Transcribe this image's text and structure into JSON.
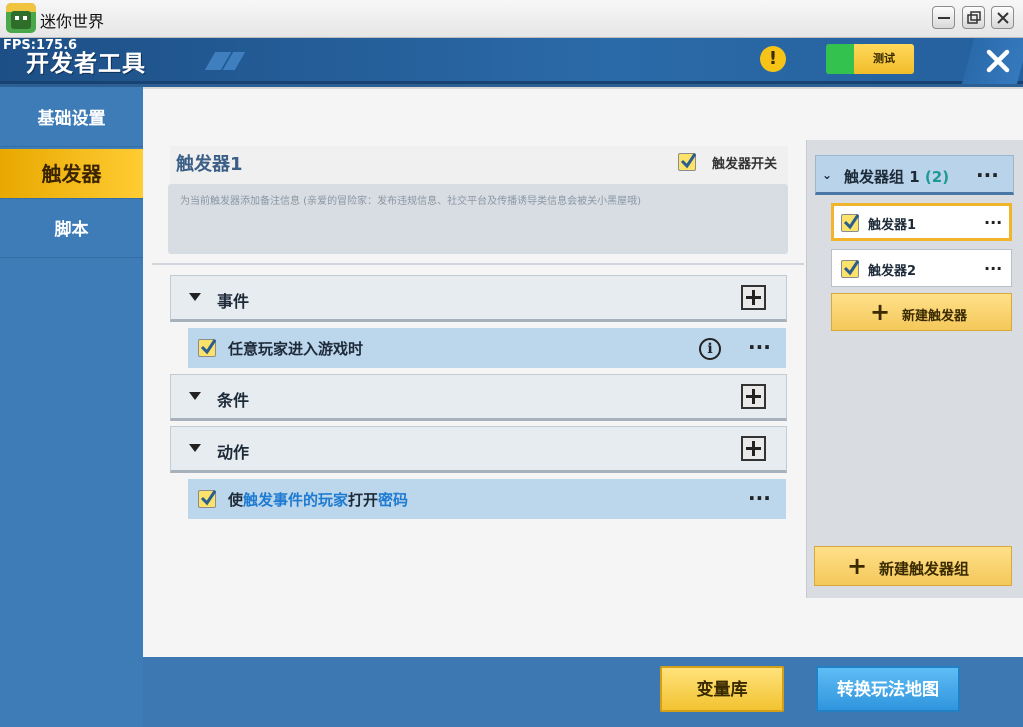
{
  "window": {
    "title": "迷你世界"
  },
  "header": {
    "fps": "FPS:175.6",
    "title": "开发者工具",
    "test_label": "测试"
  },
  "sidebar": {
    "items": [
      {
        "label": "基础设置"
      },
      {
        "label": "触发器"
      },
      {
        "label": "脚本"
      }
    ]
  },
  "trigger": {
    "name": "触发器1",
    "switch_label": "触发器开关",
    "note_placeholder": "为当前触发器添加备注信息 (亲爱的冒险家：发布违规信息、社交平台及传播诱导类信息会被关小黑屋哦)"
  },
  "sections": {
    "events": {
      "label": "事件",
      "rows": [
        {
          "text": "任意玩家进入游戏时"
        }
      ]
    },
    "conditions": {
      "label": "条件"
    },
    "actions": {
      "label": "动作",
      "rows": [
        {
          "p1": "使",
          "k1": "触发事件的玩家",
          "p2": "打开",
          "k2": "密码"
        }
      ]
    }
  },
  "right_panel": {
    "group": {
      "name": "触发器组 1",
      "count": "(2)"
    },
    "triggers": [
      {
        "name": "触发器1"
      },
      {
        "name": "触发器2"
      }
    ],
    "new_trigger": "新建触发器",
    "new_group": "新建触发器组"
  },
  "bottom": {
    "variables": "变量库",
    "convert": "转换玩法地图"
  },
  "colors": {
    "accent_yellow": "#f4c85a",
    "blue_button": "#3fa4e8",
    "keyword_blue": "#1f7bd1"
  }
}
